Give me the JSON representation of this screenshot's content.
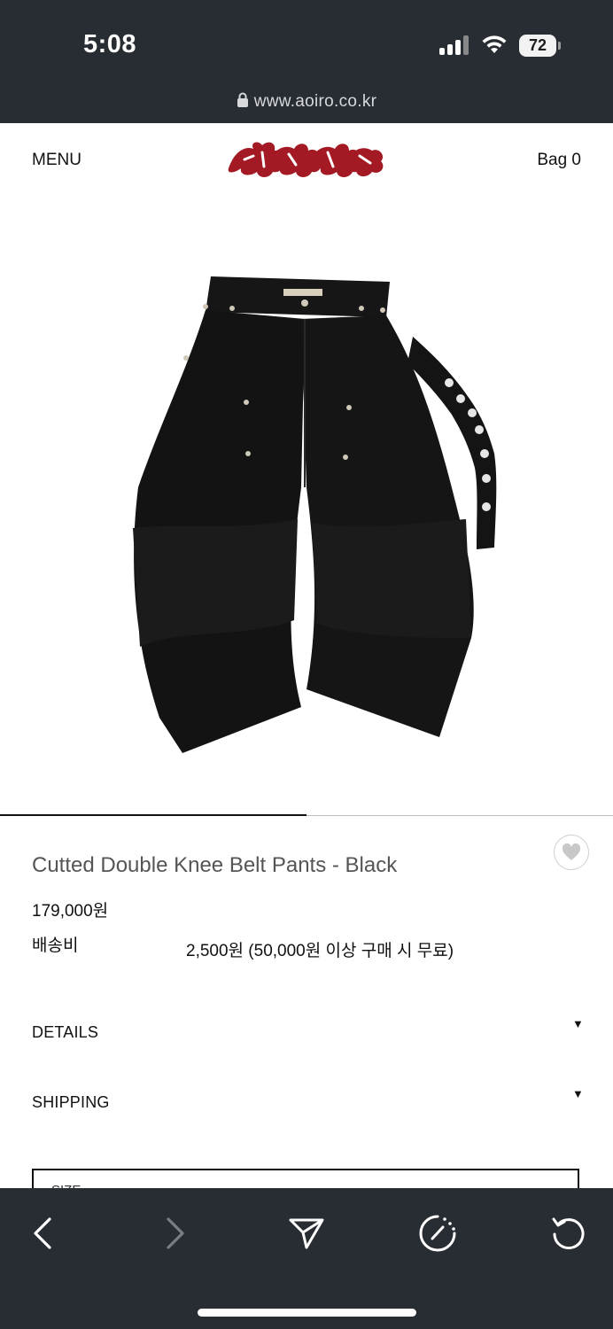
{
  "status_bar": {
    "time": "5:08",
    "battery": "72"
  },
  "browser": {
    "url": "www.aoiro.co.kr"
  },
  "header": {
    "menu_label": "MENU",
    "bag_label": "Bag 0",
    "logo_name": "aoiro-logo"
  },
  "product": {
    "image_icon": "black-double-knee-belt-pants",
    "slider_progress": 0.5,
    "title": "Cutted Double Knee Belt Pants - Black",
    "price": "179,000원",
    "shipping_label": "배송비",
    "shipping_value": "2,500원 (50,000원 이상 구매 시 무료)"
  },
  "accordion": [
    {
      "label": "DETAILS",
      "arrow": "▼"
    },
    {
      "label": "SHIPPING",
      "arrow": "▼"
    }
  ],
  "option_box": {
    "label": "SIZE"
  },
  "toolbar": {
    "buttons": [
      "back-icon",
      "forward-icon",
      "share-icon",
      "speed-dial-icon",
      "reload-icon"
    ]
  },
  "colors": {
    "logo_red": "#a31a25",
    "bar_bg": "#282c33"
  }
}
